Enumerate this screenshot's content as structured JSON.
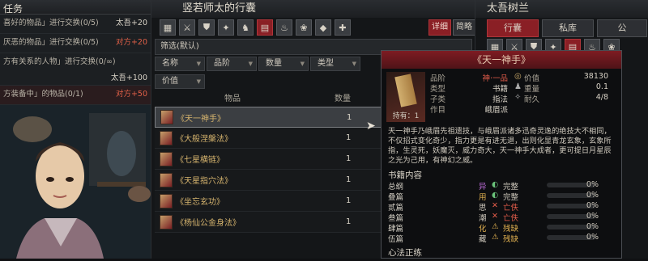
{
  "quest": {
    "header": "任务",
    "rows": [
      {
        "text": "喜好的物品」进行交换(0/5)",
        "reward": "太吾+20",
        "side": "self"
      },
      {
        "text": "厌恶的物品」进行交换(0/5)",
        "reward": "对方+20",
        "side": "other"
      },
      {
        "text": "方有关系的人物」进行交换(0/∞)",
        "reward": "太吾+100",
        "side": "self"
      },
      {
        "text": "方装备中」的物品(0/1)",
        "reward": "对方+50",
        "side": "other"
      }
    ]
  },
  "mid": {
    "title": "竖若师太的行囊",
    "detail_btn": "详细",
    "simple_btn": "简略",
    "filter": "筛选(默认)",
    "sort_buttons": [
      "名称",
      "品阶",
      "数量",
      "类型",
      "价值"
    ],
    "col_item": "物品",
    "col_qty": "数量",
    "items": [
      {
        "name": "《天一神手》",
        "qty": "1"
      },
      {
        "name": "《大般涅槃法》",
        "qty": "1"
      },
      {
        "name": "《七星横链》",
        "qty": "1"
      },
      {
        "name": "《天星指穴法》",
        "qty": "1"
      },
      {
        "name": "《坐忘玄功》",
        "qty": "1"
      },
      {
        "name": "《杨仙公金身法》",
        "qty": "1"
      }
    ]
  },
  "right": {
    "title": "太吾树兰",
    "tabs": [
      "行囊",
      "私库",
      "公"
    ]
  },
  "tooltip": {
    "title": "《天一神手》",
    "holder": "持有：1",
    "labels": {
      "grade": "品阶",
      "type": "类型",
      "subtype": "子类",
      "author": "作目"
    },
    "values": {
      "grade": "神·一品",
      "type": "书籍",
      "subtype": "指法",
      "author": "峨眉派"
    },
    "stats": {
      "value_label": "价值",
      "value": "38130",
      "weight_label": "重量",
      "weight": "0.1",
      "durability_label": "耐久",
      "durability": "4/8"
    },
    "description": "天一神手乃峨眉先祖遗技，与峨眉派诸多迅奇灵逸的绝技大不相同，不仅招式变化奇少，指力更是有进无退，出则化显青龙玄象，玄象所指，生灵死，妖魔灭，威力奇大，天一神手大成者，更可提日月星辰之光为己用，有神幻之威。",
    "section_title": "书籍内容",
    "book_rows": [
      {
        "name": "总纲",
        "mark": "异",
        "status": "完整",
        "pct": "0%"
      },
      {
        "name": "叠篇",
        "mark": "用",
        "status": "完整",
        "pct": "0%"
      },
      {
        "name": "贰篇",
        "mark": "思",
        "status": "亡佚",
        "pct": "0%"
      },
      {
        "name": "叁篇",
        "mark": "潮",
        "status": "亡佚",
        "pct": "0%"
      },
      {
        "name": "肆篇",
        "mark": "化",
        "status": "残缺",
        "pct": "0%"
      },
      {
        "name": "伍篇",
        "mark": "藏",
        "status": "残缺",
        "pct": "0%"
      }
    ],
    "footer": "心法正练"
  },
  "colors": {
    "accent_red": "#8a1f25",
    "gold_text": "#d6b46e",
    "rank_red": "#e25c4a"
  }
}
